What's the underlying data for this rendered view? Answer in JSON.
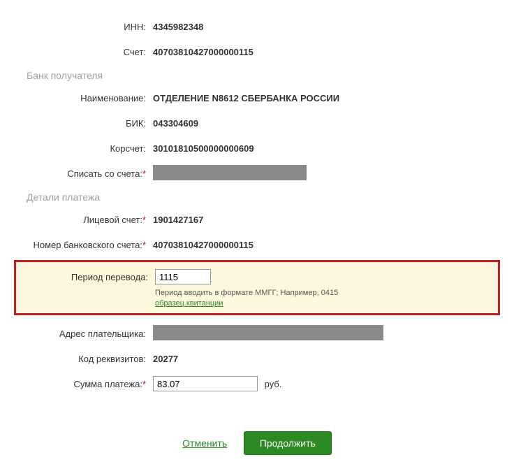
{
  "fields": {
    "inn": {
      "label": "ИНН:",
      "value": "4345982348"
    },
    "account": {
      "label": "Счет:",
      "value": "40703810427000000115"
    },
    "bank_name": {
      "label": "Наименование:",
      "value": "ОТДЕЛЕНИЕ N8612 СБЕРБАНКА РОССИИ"
    },
    "bik": {
      "label": "БИК:",
      "value": "043304609"
    },
    "corr_account": {
      "label": "Корсчет:",
      "value": "30101810500000000609"
    },
    "debit_account": {
      "label": "Списать со счета:"
    },
    "personal_account": {
      "label": "Лицевой счет:",
      "value": "1901427167"
    },
    "bank_account_num": {
      "label": "Номер банковского счета:",
      "value": "40703810427000000115"
    },
    "period": {
      "label": "Период перевода:",
      "value": "1115",
      "hint": "Период вводить в формате ММГГ; Например, 0415",
      "sample_link": "образец квитанции"
    },
    "payer_address": {
      "label": "Адрес плательщика:"
    },
    "req_code": {
      "label": "Код реквизитов:",
      "value": "20277"
    },
    "amount": {
      "label": "Сумма платежа:",
      "value": "83.07",
      "unit": "руб."
    }
  },
  "sections": {
    "bank": "Банк получателя",
    "details": "Детали платежа"
  },
  "buttons": {
    "cancel": "Отменить",
    "continue": "Продолжить"
  }
}
